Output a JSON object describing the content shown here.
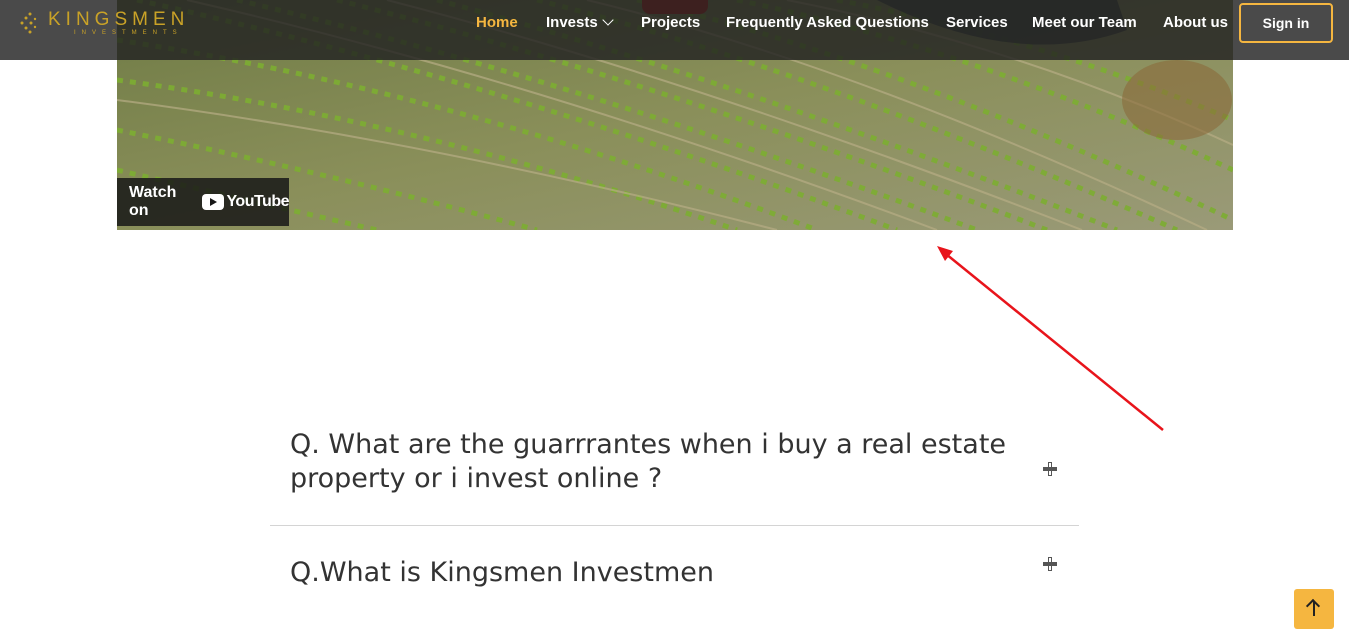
{
  "brand": {
    "name": "KINGSMEN",
    "tagline": "INVESTMENTS",
    "accent_color": "#f5b640"
  },
  "nav": {
    "items": [
      {
        "label": "Home",
        "active": true
      },
      {
        "label": "Invests",
        "has_dropdown": true
      },
      {
        "label": "Projects"
      },
      {
        "label": "Frequently Asked Questions"
      },
      {
        "label": "Services"
      },
      {
        "label": "Meet our Team"
      },
      {
        "label": "About us"
      }
    ],
    "signin_label": "Sign in"
  },
  "video": {
    "watch_label": "Watch on",
    "platform_label": "YouTube"
  },
  "faq": [
    {
      "question": "Q. What are the guarrrantes when i buy a real estate property or i invest online ?",
      "icon": "plus-icon"
    },
    {
      "question": "Q.What is Kingsmen Investmen",
      "icon": "plus-icon"
    }
  ],
  "annotation": {
    "color": "#e8141b",
    "icon": "red-arrow"
  },
  "back_to_top": {
    "icon": "arrow-up-icon"
  }
}
